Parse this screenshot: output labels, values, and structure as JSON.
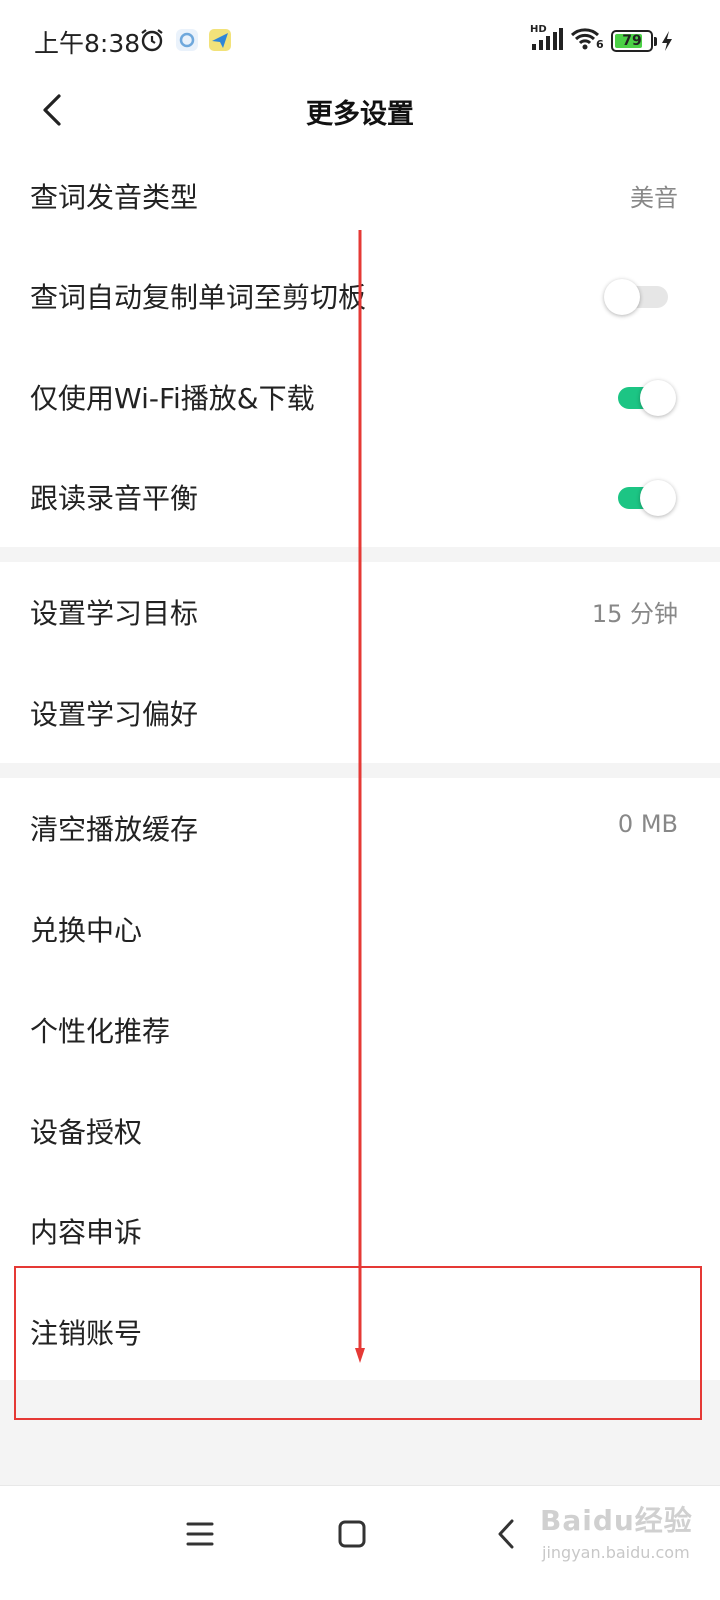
{
  "status_bar": {
    "time": "上午8:38",
    "network_type": "HD",
    "wifi_generation": "6",
    "battery_level": "79",
    "battery_fraction": 0.79,
    "icons": [
      "alarm-icon",
      "sync-app-icon",
      "send-app-icon",
      "signal-icon",
      "wifi-icon",
      "battery-icon",
      "charging-icon"
    ]
  },
  "header": {
    "title": "更多设置",
    "back_icon": "chevron-left-icon"
  },
  "sections": [
    {
      "items": [
        {
          "label": "查词发音类型",
          "value": "美音"
        },
        {
          "label": "查词自动复制单词至剪切板",
          "toggle": false
        },
        {
          "label": "仅使用Wi-Fi播放&下载",
          "toggle": true
        },
        {
          "label": "跟读录音平衡",
          "toggle": true
        }
      ]
    },
    {
      "items": [
        {
          "label": "设置学习目标",
          "value": "15 分钟"
        },
        {
          "label": "设置学习偏好"
        }
      ]
    },
    {
      "items": [
        {
          "label": "清空播放缓存",
          "value": "0 MB"
        },
        {
          "label": "兑换中心"
        },
        {
          "label": "个性化推荐"
        },
        {
          "label": "设备授权"
        },
        {
          "label": "内容申诉"
        },
        {
          "label": "注销账号"
        }
      ]
    }
  ],
  "nav_bar": {
    "buttons": [
      "menu-icon",
      "home-square-icon",
      "back-chevron-icon"
    ]
  },
  "colors": {
    "toggle_on": "#1cc584",
    "toggle_off": "#e6e6e6",
    "annotation": "#e53935",
    "section_gap": "#f4f4f4"
  },
  "watermark": {
    "brand": "Baidu经验",
    "url": "jingyan.baidu.com"
  }
}
